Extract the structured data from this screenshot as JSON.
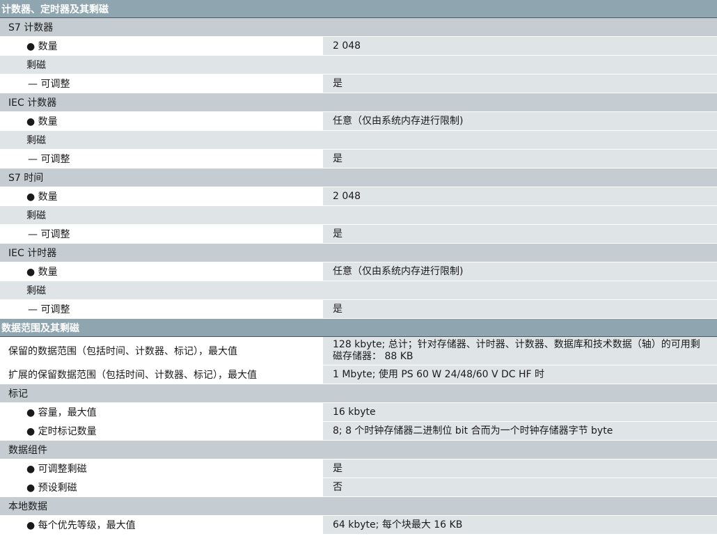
{
  "rows": [
    {
      "kind": "section",
      "label": "计数器、定时器及其剩磁"
    },
    {
      "kind": "group",
      "label": "S7 计数器"
    },
    {
      "kind": "item",
      "indent": 1,
      "label": "● 数量",
      "value": "2 048"
    },
    {
      "kind": "item",
      "indent": 1,
      "label": "剩磁",
      "value": "",
      "shade": true
    },
    {
      "kind": "item",
      "indent": 2,
      "label": "— 可调整",
      "value": "是"
    },
    {
      "kind": "group",
      "label": "IEC 计数器"
    },
    {
      "kind": "item",
      "indent": 1,
      "label": "● 数量",
      "value": "任意（仅由系统内存进行限制)"
    },
    {
      "kind": "item",
      "indent": 1,
      "label": "剩磁",
      "value": "",
      "shade": true
    },
    {
      "kind": "item",
      "indent": 2,
      "label": "— 可调整",
      "value": "是"
    },
    {
      "kind": "group",
      "label": "S7 时间"
    },
    {
      "kind": "item",
      "indent": 1,
      "label": "● 数量",
      "value": "2 048"
    },
    {
      "kind": "item",
      "indent": 1,
      "label": "剩磁",
      "value": "",
      "shade": true
    },
    {
      "kind": "item",
      "indent": 2,
      "label": "— 可调整",
      "value": "是"
    },
    {
      "kind": "group",
      "label": "IEC 计时器"
    },
    {
      "kind": "item",
      "indent": 1,
      "label": "● 数量",
      "value": "任意（仅由系统内存进行限制)"
    },
    {
      "kind": "item",
      "indent": 1,
      "label": "剩磁",
      "value": "",
      "shade": true
    },
    {
      "kind": "item",
      "indent": 2,
      "label": "— 可调整",
      "value": "是"
    },
    {
      "kind": "section",
      "label": "数据范围及其剩磁"
    },
    {
      "kind": "item",
      "indent": 0,
      "label": "保留的数据范围（包括时间、计数器、标记），最大值",
      "value": "128 kbyte; 总计；针对存储器、计时器、计数器、数据库和技术数据（轴）的可用剩磁存储器： 88 KB"
    },
    {
      "kind": "item",
      "indent": 0,
      "label": "扩展的保留数据范围（包括时间、计数器、标记），最大值",
      "value": "1 Mbyte; 使用 PS 60 W 24/48/60 V DC HF 时"
    },
    {
      "kind": "group",
      "label": "标记"
    },
    {
      "kind": "item",
      "indent": 1,
      "label": "● 容量，最大值",
      "value": "16 kbyte"
    },
    {
      "kind": "item",
      "indent": 1,
      "label": "● 定时标记数量",
      "value": "8; 8 个时钟存储器二进制位 bit 合而为一个时钟存储器字节 byte"
    },
    {
      "kind": "group",
      "label": "数据组件"
    },
    {
      "kind": "item",
      "indent": 1,
      "label": "● 可调整剩磁",
      "value": "是"
    },
    {
      "kind": "item",
      "indent": 1,
      "label": "● 预设剩磁",
      "value": "否"
    },
    {
      "kind": "group",
      "label": "本地数据"
    },
    {
      "kind": "item",
      "indent": 1,
      "label": "● 每个优先等级，最大值",
      "value": "64 kbyte; 每个块最大 16 KB"
    }
  ]
}
